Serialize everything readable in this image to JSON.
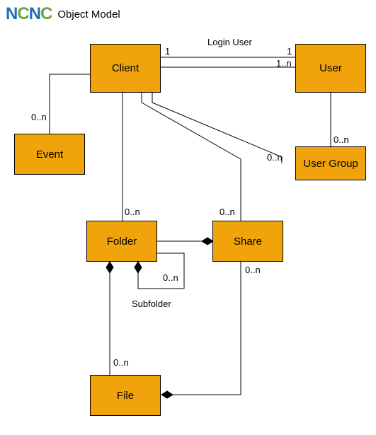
{
  "title": "Object Model",
  "logo_letters": [
    "N",
    "C",
    "N",
    "C"
  ],
  "entities": {
    "client": "Client",
    "user": "User",
    "event": "Event",
    "user_group": "User Group",
    "folder": "Folder",
    "share": "Share",
    "file": "File"
  },
  "relationships": {
    "client_user_login": {
      "label": "Login User",
      "client_mult": "1",
      "user_mult": "1"
    },
    "client_user_lower": {
      "user_mult": "1..n"
    },
    "client_event": {
      "event_mult": "0..n"
    },
    "client_folder": {
      "folder_mult": "0..n"
    },
    "client_share": {
      "share_mult": "0..n"
    },
    "client_usergroup": {
      "group_mult": "0..n"
    },
    "user_usergroup": {
      "group_mult": "0..n"
    },
    "folder_subfolder": {
      "label": "Subfolder",
      "mult": "0..n"
    },
    "folder_file": {
      "mult": "0..n"
    },
    "share_file": {
      "mult": "0..n"
    }
  }
}
